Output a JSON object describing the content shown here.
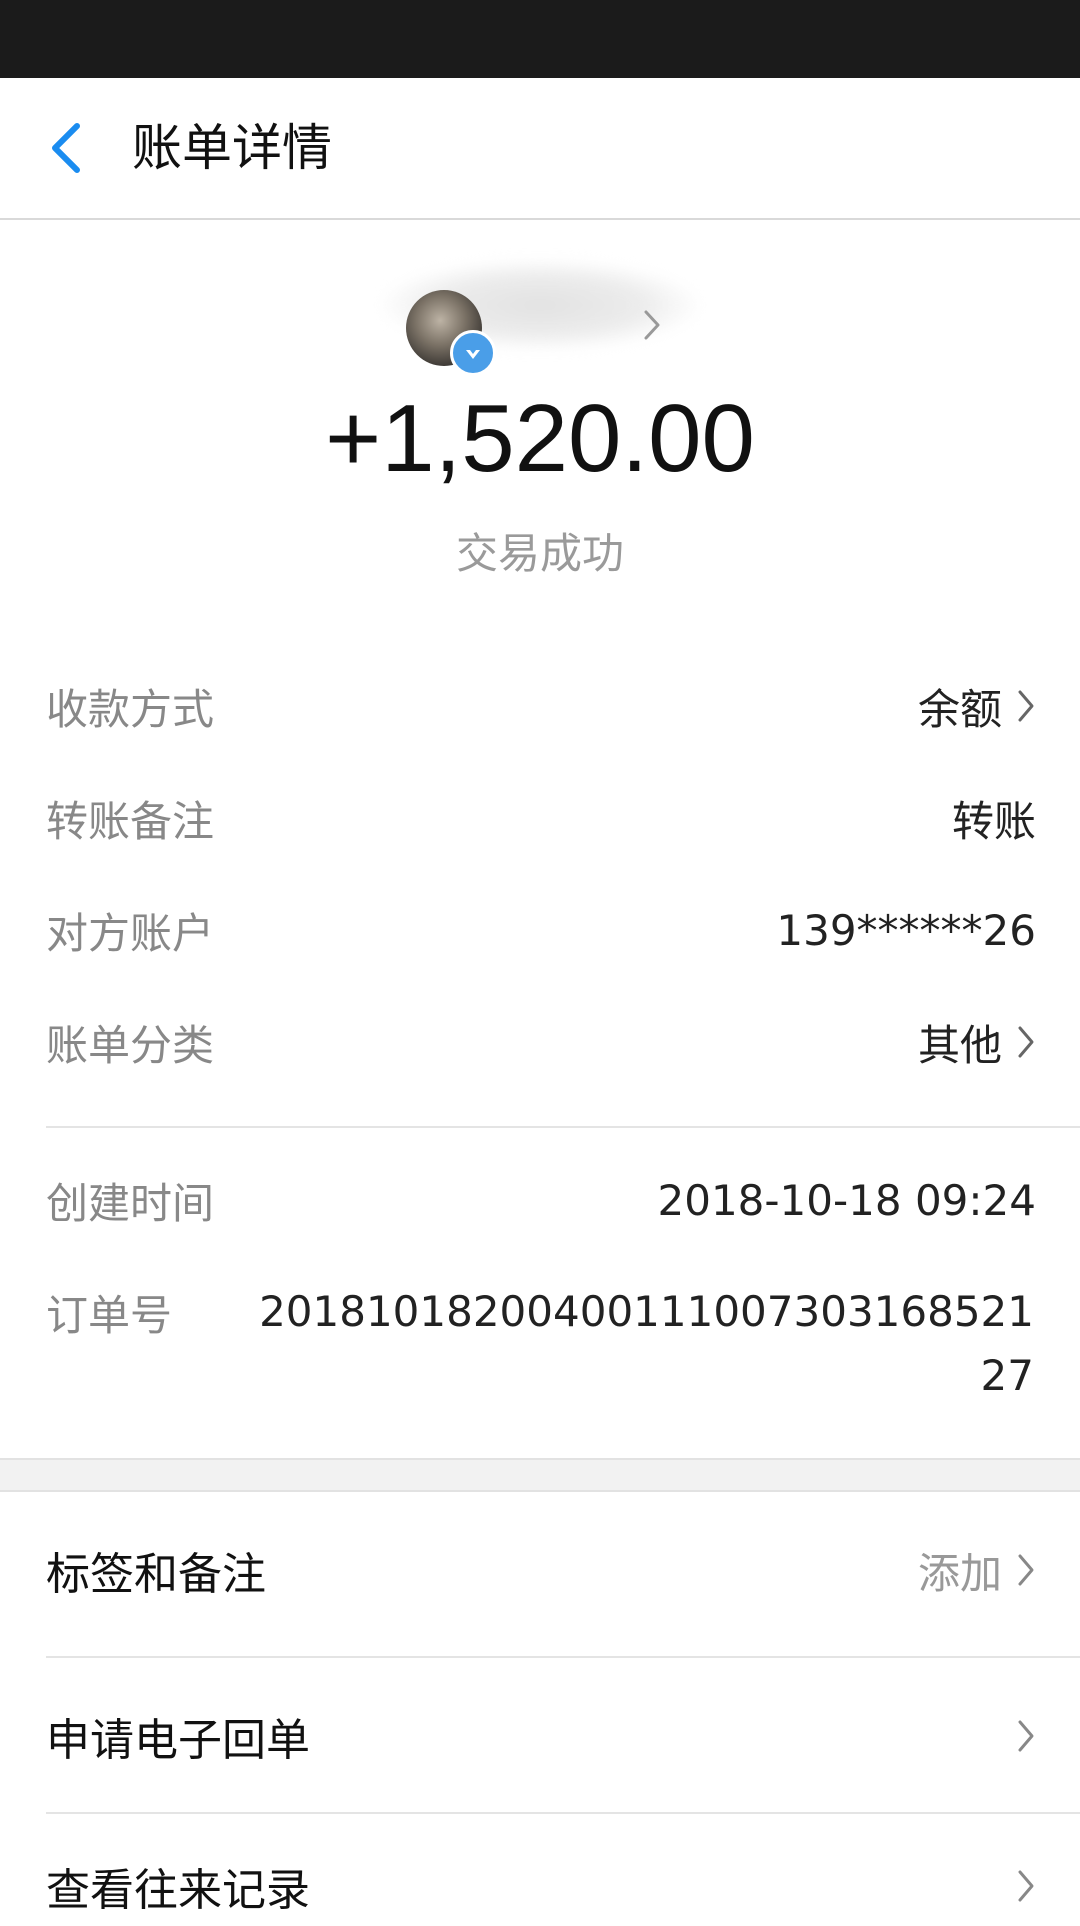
{
  "nav": {
    "title": "账单详情"
  },
  "header": {
    "amount": "+1,520.00",
    "status": "交易成功"
  },
  "details": [
    {
      "label": "收款方式",
      "value": "余额",
      "has_chevron": true
    },
    {
      "label": "转账备注",
      "value": "转账",
      "has_chevron": false
    },
    {
      "label": "对方账户",
      "value": "139******26",
      "has_chevron": false
    },
    {
      "label": "账单分类",
      "value": "其他",
      "has_chevron": true
    }
  ],
  "meta": {
    "created_label": "创建时间",
    "created_value": "2018-10-18 09:24",
    "order_label": "订单号",
    "order_value": "2018101820040011100730316852127"
  },
  "actions": [
    {
      "label": "标签和备注",
      "value": "添加"
    },
    {
      "label": "申请电子回单",
      "value": ""
    },
    {
      "label": "查看往来记录",
      "value": ""
    }
  ],
  "colors": {
    "accent": "#1a8cf0",
    "secondary_text": "#888888",
    "badge": "#4a9ee8"
  },
  "icons": {
    "back": "chevron-left-icon",
    "row": "chevron-right-icon",
    "badge": "verified-badge-icon"
  }
}
